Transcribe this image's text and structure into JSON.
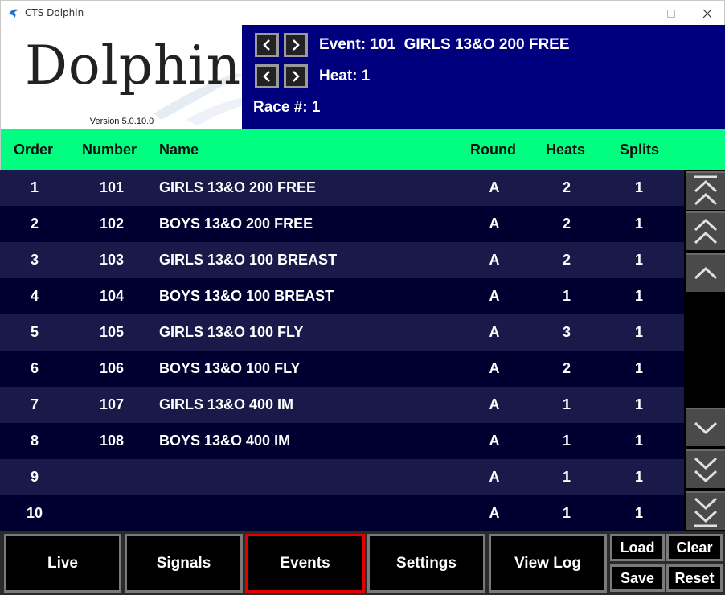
{
  "window": {
    "title": "CTS Dolphin"
  },
  "logo": {
    "text": "Dolphin",
    "version": "Version 5.0.10.0"
  },
  "info": {
    "event_label": "Event:",
    "event_number": "101",
    "event_name": "GIRLS 13&O 200 FREE",
    "heat_label": "Heat:",
    "heat_value": "1",
    "race_label": "Race #:",
    "race_value": "1"
  },
  "columns": {
    "order": "Order",
    "number": "Number",
    "name": "Name",
    "round": "Round",
    "heats": "Heats",
    "splits": "Splits"
  },
  "rows": [
    {
      "order": "1",
      "number": "101",
      "name": "GIRLS 13&O 200 FREE",
      "round": "A",
      "heats": "2",
      "splits": "1"
    },
    {
      "order": "2",
      "number": "102",
      "name": "BOYS 13&O 200 FREE",
      "round": "A",
      "heats": "2",
      "splits": "1"
    },
    {
      "order": "3",
      "number": "103",
      "name": "GIRLS 13&O 100 BREAST",
      "round": "A",
      "heats": "2",
      "splits": "1"
    },
    {
      "order": "4",
      "number": "104",
      "name": "BOYS 13&O 100 BREAST",
      "round": "A",
      "heats": "1",
      "splits": "1"
    },
    {
      "order": "5",
      "number": "105",
      "name": "GIRLS 13&O 100 FLY",
      "round": "A",
      "heats": "3",
      "splits": "1"
    },
    {
      "order": "6",
      "number": "106",
      "name": "BOYS 13&O 100 FLY",
      "round": "A",
      "heats": "2",
      "splits": "1"
    },
    {
      "order": "7",
      "number": "107",
      "name": "GIRLS 13&O 400 IM",
      "round": "A",
      "heats": "1",
      "splits": "1"
    },
    {
      "order": "8",
      "number": "108",
      "name": "BOYS 13&O 400 IM",
      "round": "A",
      "heats": "1",
      "splits": "1"
    },
    {
      "order": "9",
      "number": "",
      "name": "",
      "round": "A",
      "heats": "1",
      "splits": "1"
    },
    {
      "order": "10",
      "number": "",
      "name": "",
      "round": "A",
      "heats": "1",
      "splits": "1"
    }
  ],
  "toolbar": {
    "live": "Live",
    "signals": "Signals",
    "events": "Events",
    "settings": "Settings",
    "view_log": "View Log",
    "load": "Load",
    "clear": "Clear",
    "save": "Save",
    "reset": "Reset",
    "active_tab": "events"
  },
  "colors": {
    "info_bg": "#00007f",
    "header_bg": "#00ff80",
    "row_odd": "#1a1a4a",
    "row_even": "#000030",
    "active_border": "#e00000"
  },
  "icons": {
    "app": "dolphin-icon",
    "prev": "chevron-left-icon",
    "next": "chevron-right-icon",
    "scroll_top": "scroll-top-icon",
    "scroll_page_up": "double-chevron-up-icon",
    "scroll_up": "chevron-up-icon",
    "scroll_down": "chevron-down-icon",
    "scroll_page_down": "double-chevron-down-icon",
    "scroll_bottom": "scroll-bottom-icon"
  }
}
